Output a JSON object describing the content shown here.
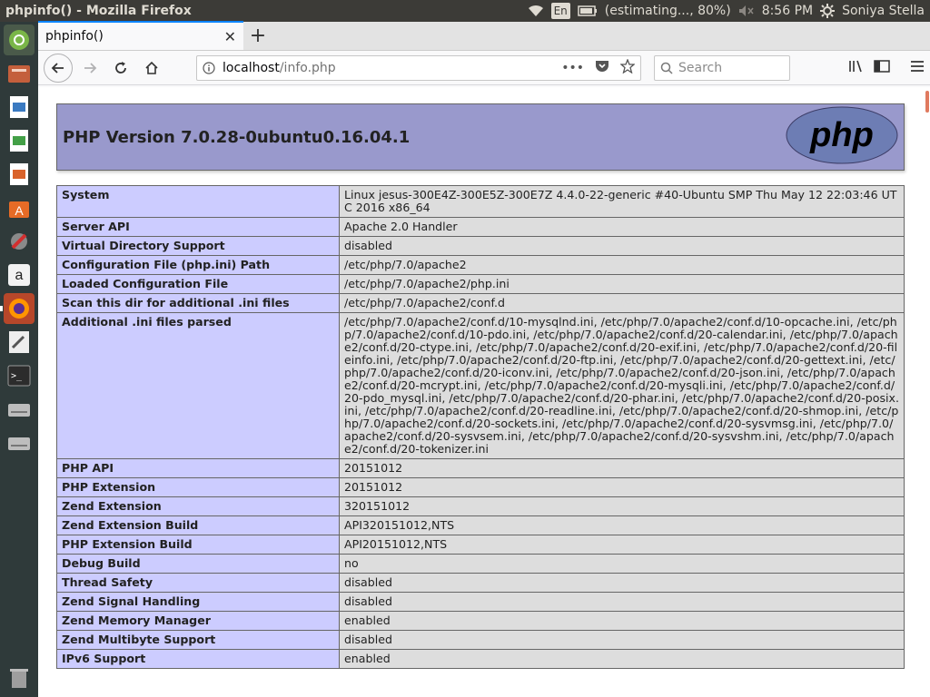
{
  "topbar": {
    "window_title": "phpinfo() - Mozilla Firefox",
    "language": "En",
    "battery": "(estimating..., 80%)",
    "time": "8:56 PM",
    "user": "Soniya Stella"
  },
  "launcher": {
    "items": [
      "ubuntu-icon",
      "files-icon",
      "writer-icon",
      "calc-icon",
      "impress-icon",
      "software-center-icon",
      "settings-icon",
      "amazon-icon",
      "firefox-icon",
      "text-editor-icon",
      "terminal-icon",
      "drive-icon",
      "drive-icon-2"
    ],
    "trash": "trash-icon"
  },
  "browser": {
    "tab_title": "phpinfo()",
    "url_host": "localhost",
    "url_path": "/info.php",
    "search_placeholder": "Search"
  },
  "phpinfo": {
    "version_title": "PHP Version 7.0.28-0ubuntu0.16.04.1",
    "logo_text": "php",
    "rows": [
      {
        "key": "System",
        "value": "Linux jesus-300E4Z-300E5Z-300E7Z 4.4.0-22-generic #40-Ubuntu SMP Thu May 12 22:03:46 UTC 2016 x86_64"
      },
      {
        "key": "Server API",
        "value": "Apache 2.0 Handler"
      },
      {
        "key": "Virtual Directory Support",
        "value": "disabled"
      },
      {
        "key": "Configuration File (php.ini) Path",
        "value": "/etc/php/7.0/apache2"
      },
      {
        "key": "Loaded Configuration File",
        "value": "/etc/php/7.0/apache2/php.ini"
      },
      {
        "key": "Scan this dir for additional .ini files",
        "value": "/etc/php/7.0/apache2/conf.d"
      },
      {
        "key": "Additional .ini files parsed",
        "value": "/etc/php/7.0/apache2/conf.d/10-mysqlnd.ini, /etc/php/7.0/apache2/conf.d/10-opcache.ini, /etc/php/7.0/apache2/conf.d/10-pdo.ini, /etc/php/7.0/apache2/conf.d/20-calendar.ini, /etc/php/7.0/apache2/conf.d/20-ctype.ini, /etc/php/7.0/apache2/conf.d/20-exif.ini, /etc/php/7.0/apache2/conf.d/20-fileinfo.ini, /etc/php/7.0/apache2/conf.d/20-ftp.ini, /etc/php/7.0/apache2/conf.d/20-gettext.ini, /etc/php/7.0/apache2/conf.d/20-iconv.ini, /etc/php/7.0/apache2/conf.d/20-json.ini, /etc/php/7.0/apache2/conf.d/20-mcrypt.ini, /etc/php/7.0/apache2/conf.d/20-mysqli.ini, /etc/php/7.0/apache2/conf.d/20-pdo_mysql.ini, /etc/php/7.0/apache2/conf.d/20-phar.ini, /etc/php/7.0/apache2/conf.d/20-posix.ini, /etc/php/7.0/apache2/conf.d/20-readline.ini, /etc/php/7.0/apache2/conf.d/20-shmop.ini, /etc/php/7.0/apache2/conf.d/20-sockets.ini, /etc/php/7.0/apache2/conf.d/20-sysvmsg.ini, /etc/php/7.0/apache2/conf.d/20-sysvsem.ini, /etc/php/7.0/apache2/conf.d/20-sysvshm.ini, /etc/php/7.0/apache2/conf.d/20-tokenizer.ini"
      },
      {
        "key": "PHP API",
        "value": "20151012"
      },
      {
        "key": "PHP Extension",
        "value": "20151012"
      },
      {
        "key": "Zend Extension",
        "value": "320151012"
      },
      {
        "key": "Zend Extension Build",
        "value": "API320151012,NTS"
      },
      {
        "key": "PHP Extension Build",
        "value": "API20151012,NTS"
      },
      {
        "key": "Debug Build",
        "value": "no"
      },
      {
        "key": "Thread Safety",
        "value": "disabled"
      },
      {
        "key": "Zend Signal Handling",
        "value": "disabled"
      },
      {
        "key": "Zend Memory Manager",
        "value": "enabled"
      },
      {
        "key": "Zend Multibyte Support",
        "value": "disabled"
      },
      {
        "key": "IPv6 Support",
        "value": "enabled"
      }
    ]
  },
  "colors": {
    "header_bg": "#9999cc",
    "key_bg": "#ccccff",
    "value_bg": "#dddddd",
    "launcher_bg": "#2f3a3a",
    "panel_bg": "#3c3b37"
  }
}
